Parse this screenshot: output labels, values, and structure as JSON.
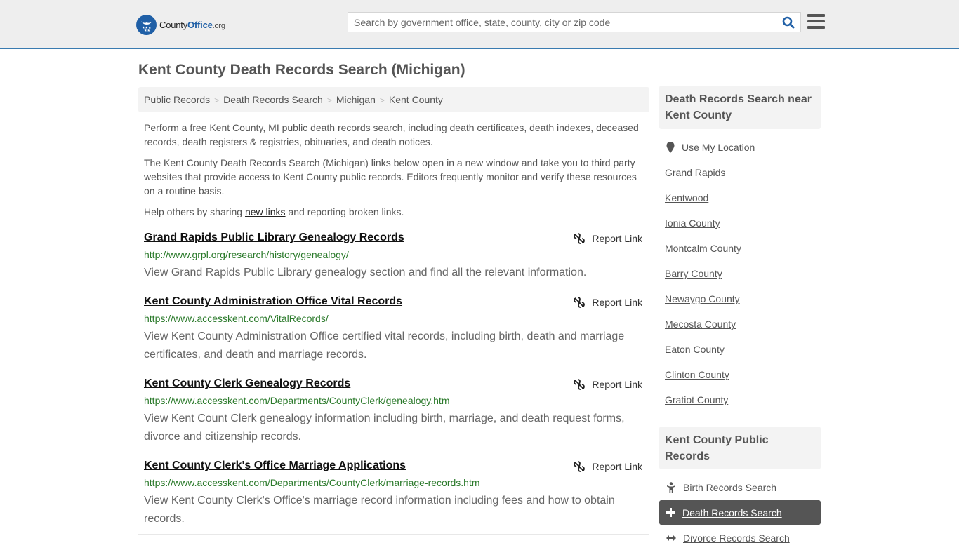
{
  "header": {
    "logo": {
      "county": "County",
      "office": "Office",
      "org": ".org"
    },
    "search_placeholder": "Search by government office, state, county, city or zip code",
    "search_value": ""
  },
  "page_title": "Kent County Death Records Search (Michigan)",
  "breadcrumb": [
    "Public Records",
    "Death Records Search",
    "Michigan",
    "Kent County"
  ],
  "breadcrumb_separator": ">",
  "intro": {
    "p1": "Perform a free Kent County, MI public death records search, including death certificates, death indexes, deceased records, death registers & registries, obituaries, and death notices.",
    "p2": "The Kent County Death Records Search (Michigan) links below open in a new window and take you to third party websites that provide access to Kent County public records. Editors frequently monitor and verify these resources on a routine basis.",
    "p3_before": "Help others by sharing ",
    "p3_link": "new links",
    "p3_after": " and reporting broken links."
  },
  "report_label": "Report Link",
  "results": [
    {
      "title": "Grand Rapids Public Library Genealogy Records",
      "url": "http://www.grpl.org/research/history/genealogy/",
      "description": "View Grand Rapids Public Library genealogy section and find all the relevant information."
    },
    {
      "title": "Kent County Administration Office Vital Records",
      "url": "https://www.accesskent.com/VitalRecords/",
      "description": "View Kent County Administration Office certified vital records, including birth, death and marriage certificates, and death and marriage records."
    },
    {
      "title": "Kent County Clerk Genealogy Records",
      "url": "https://www.accesskent.com/Departments/CountyClerk/genealogy.htm",
      "description": "View Kent Count Clerk genealogy information including birth, marriage, and death request forms, divorce and citizenship records."
    },
    {
      "title": "Kent County Clerk's Office Marriage Applications",
      "url": "https://www.accesskent.com/Departments/CountyClerk/marriage-records.htm",
      "description": "View Kent County Clerk's Office's marriage record information including fees and how to obtain records."
    }
  ],
  "sidebar": {
    "nearby_heading": "Death Records Search near Kent County",
    "use_location": "Use My Location",
    "nearby": [
      "Grand Rapids",
      "Kentwood",
      "Ionia County",
      "Montcalm County",
      "Barry County",
      "Newaygo County",
      "Mecosta County",
      "Eaton County",
      "Clinton County",
      "Gratiot County"
    ],
    "public_heading": "Kent County Public Records",
    "public_records": [
      {
        "label": "Birth Records Search",
        "icon": "child-icon",
        "active": false
      },
      {
        "label": "Death Records Search",
        "icon": "cross-icon",
        "active": true
      },
      {
        "label": "Divorce Records Search",
        "icon": "arrows-horizontal-icon",
        "active": false
      }
    ]
  },
  "colors": {
    "brand_blue": "#1f5fa6",
    "header_border": "#3a7bb0",
    "url_green": "#2b7a2b",
    "active_bg": "#555555"
  }
}
